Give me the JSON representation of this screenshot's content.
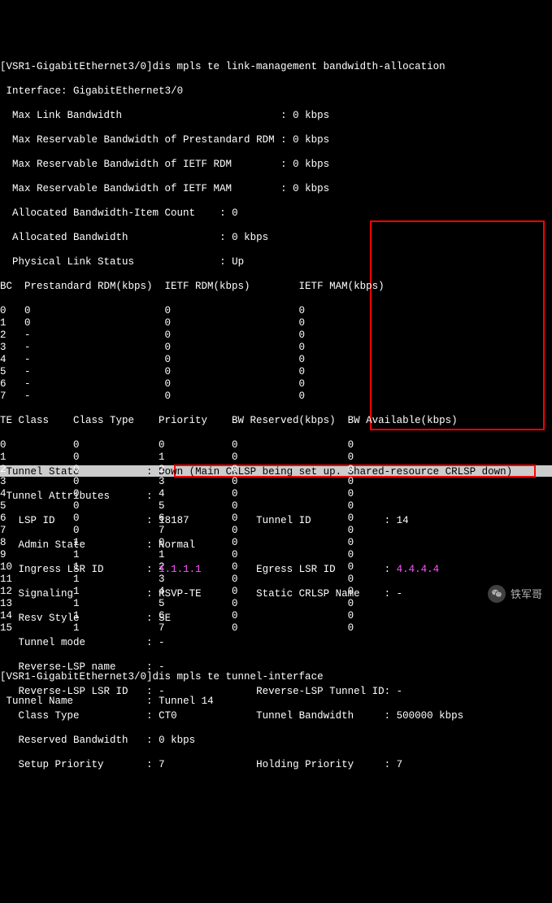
{
  "cmd1": {
    "prompt": "[VSR1-GigabitEthernet3/0]",
    "command": "dis mpls te link-management bandwidth-allocation",
    "interface_label": "Interface:",
    "interface": "GigabitEthernet3/0",
    "max_link_bw_label": "Max Link Bandwidth",
    "max_link_bw": "0 kbps",
    "max_resv_prestd_label": "Max Reservable Bandwidth of Prestandard RDM",
    "max_resv_prestd": "0 kbps",
    "max_resv_ietf_rdm_label": "Max Reservable Bandwidth of IETF RDM",
    "max_resv_ietf_rdm": "0 kbps",
    "max_resv_ietf_mam_label": "Max Reservable Bandwidth of IETF MAM",
    "max_resv_ietf_mam": "0 kbps",
    "alloc_bw_item_count_label": "Allocated Bandwidth-Item Count",
    "alloc_bw_item_count": "0",
    "alloc_bw_label": "Allocated Bandwidth",
    "alloc_bw": "0 kbps",
    "phys_link_status_label": "Physical Link Status",
    "phys_link_status": "Up",
    "bc_hdr": "BC  Prestandard RDM(kbps)  IETF RDM(kbps)        IETF MAM(kbps)",
    "bc_rows": [
      {
        "bc": "0",
        "pre": "0",
        "rdm": "0",
        "mam": "0"
      },
      {
        "bc": "1",
        "pre": "0",
        "rdm": "0",
        "mam": "0"
      },
      {
        "bc": "2",
        "pre": "-",
        "rdm": "0",
        "mam": "0"
      },
      {
        "bc": "3",
        "pre": "-",
        "rdm": "0",
        "mam": "0"
      },
      {
        "bc": "4",
        "pre": "-",
        "rdm": "0",
        "mam": "0"
      },
      {
        "bc": "5",
        "pre": "-",
        "rdm": "0",
        "mam": "0"
      },
      {
        "bc": "6",
        "pre": "-",
        "rdm": "0",
        "mam": "0"
      },
      {
        "bc": "7",
        "pre": "-",
        "rdm": "0",
        "mam": "0"
      }
    ],
    "te_hdr": "TE Class    Class Type    Priority    BW Reserved(kbps)  BW Available(kbps)",
    "te_rows": [
      {
        "te": "0",
        "ct": "0",
        "pr": "0",
        "bwr": "0",
        "bwa": "0"
      },
      {
        "te": "1",
        "ct": "0",
        "pr": "1",
        "bwr": "0",
        "bwa": "0"
      },
      {
        "te": "2",
        "ct": "0",
        "pr": "2",
        "bwr": "0",
        "bwa": "0"
      },
      {
        "te": "3",
        "ct": "0",
        "pr": "3",
        "bwr": "0",
        "bwa": "0"
      },
      {
        "te": "4",
        "ct": "0",
        "pr": "4",
        "bwr": "0",
        "bwa": "0"
      },
      {
        "te": "5",
        "ct": "0",
        "pr": "5",
        "bwr": "0",
        "bwa": "0"
      },
      {
        "te": "6",
        "ct": "0",
        "pr": "6",
        "bwr": "0",
        "bwa": "0"
      },
      {
        "te": "7",
        "ct": "0",
        "pr": "7",
        "bwr": "0",
        "bwa": "0"
      },
      {
        "te": "8",
        "ct": "1",
        "pr": "0",
        "bwr": "0",
        "bwa": "0"
      },
      {
        "te": "9",
        "ct": "1",
        "pr": "1",
        "bwr": "0",
        "bwa": "0"
      },
      {
        "te": "10",
        "ct": "1",
        "pr": "2",
        "bwr": "0",
        "bwa": "0"
      },
      {
        "te": "11",
        "ct": "1",
        "pr": "3",
        "bwr": "0",
        "bwa": "0"
      },
      {
        "te": "12",
        "ct": "1",
        "pr": "4",
        "bwr": "0",
        "bwa": "0"
      },
      {
        "te": "13",
        "ct": "1",
        "pr": "5",
        "bwr": "0",
        "bwa": "0"
      },
      {
        "te": "14",
        "ct": "1",
        "pr": "6",
        "bwr": "0",
        "bwa": "0"
      },
      {
        "te": "15",
        "ct": "1",
        "pr": "7",
        "bwr": "0",
        "bwa": "0"
      }
    ]
  },
  "cmd2": {
    "prompt": "[VSR1-GigabitEthernet3/0]",
    "command": "dis mpls te tunnel-interface",
    "tunnel_name_label": "Tunnel Name",
    "tunnel_name": "Tunnel 14",
    "tunnel_state_label": "Tunnel State",
    "tunnel_state": "Down (Main CRLSP being set up. Shared-resource CRLSP down)",
    "tunnel_attributes_label": "Tunnel Attributes",
    "lsp_id_label": "LSP ID",
    "lsp_id": "18187",
    "tunnel_id_label": "Tunnel ID",
    "tunnel_id": "14",
    "admin_state_label": "Admin State",
    "admin_state": "Normal",
    "ingress_lsr_label": "Ingress LSR ID",
    "ingress_lsr": "1.1.1.1",
    "egress_lsr_label": "Egress LSR ID",
    "egress_lsr": "4.4.4.4",
    "signaling_label": "Signaling",
    "signaling": "RSVP-TE",
    "static_crlsp_label": "Static CRLSP Name",
    "static_crlsp": "-",
    "resv_style_label": "Resv Style",
    "resv_style": "SE",
    "tunnel_mode_label": "Tunnel mode",
    "tunnel_mode": "-",
    "rlsp_name_label": "Reverse-LSP name",
    "rlsp_name": "-",
    "rlsp_lsr_label": "Reverse-LSP LSR ID",
    "rlsp_lsr": "-",
    "rlsp_tunnel_label": "Reverse-LSP Tunnel ID:",
    "rlsp_tunnel": "-",
    "class_type_label": "Class Type",
    "class_type": "CT0",
    "tunnel_bw_label": "Tunnel Bandwidth",
    "tunnel_bw": "500000 kbps",
    "reserved_bw_label": "Reserved Bandwidth",
    "reserved_bw": "0 kbps",
    "setup_pri_label": "Setup Priority",
    "setup_pri": "7",
    "holding_pri_label": "Holding Priority",
    "holding_pri": "7"
  },
  "watermark": "铁军哥"
}
